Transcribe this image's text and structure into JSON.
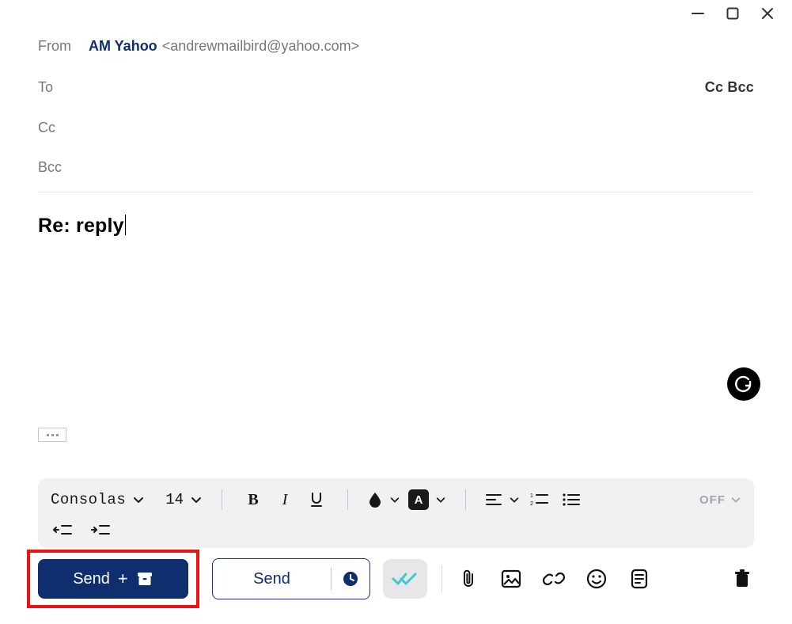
{
  "titlebar": {
    "minimize": "minimize-icon",
    "maximize": "maximize-icon",
    "close": "close-icon"
  },
  "header": {
    "from_label": "From",
    "account_name": "AM Yahoo",
    "account_email": "<andrewmailbird@yahoo.com>",
    "to_label": "To",
    "cc_toggle": "Cc",
    "bcc_toggle": "Bcc",
    "cc_label": "Cc",
    "bcc_label": "Bcc"
  },
  "subject": "Re: reply",
  "formatting": {
    "font_name": "Consolas",
    "font_size": "14",
    "off_label": "OFF"
  },
  "actions": {
    "send_primary": "Send",
    "send_plus": "+",
    "send_outline": "Send"
  }
}
